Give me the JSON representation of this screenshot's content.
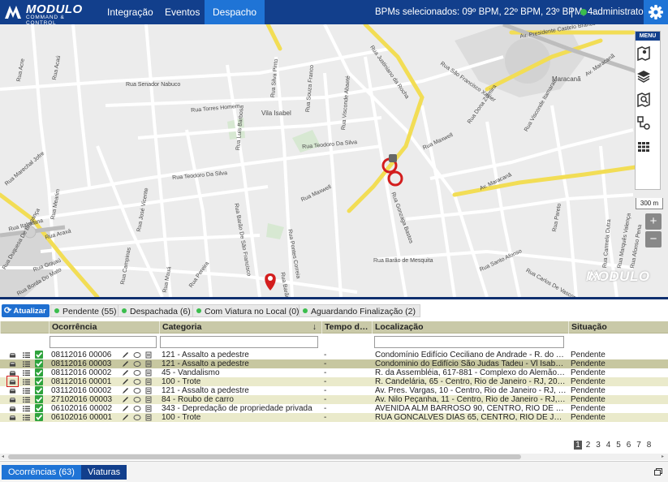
{
  "brand": {
    "name": "MODULO",
    "tagline": "COMMAND & CONTROL"
  },
  "nav": {
    "tabs": [
      {
        "label": "Integração"
      },
      {
        "label": "Eventos"
      },
      {
        "label": "Despacho",
        "active": true
      }
    ],
    "bpms": "BPMs selecionados: 09º BPM, 22º BPM, 23º BPM, 4…",
    "separator": "|",
    "user": "administrator",
    "user_status_color": "#3bbd4d"
  },
  "map": {
    "menu_label": "MENU",
    "scale": "300 m",
    "zoom_in": "+",
    "zoom_out": "−",
    "watermark": "MODULO",
    "tools": [
      "map-pin-icon",
      "layers-icon",
      "search-map-icon",
      "route-icon",
      "grid-icon"
    ],
    "streets": [
      "Rua Acre",
      "Rua Acaú",
      "Rua Senador Nabuco",
      "Rua Torres Homem",
      "Vila Isabel",
      "Rua Silva Pinto",
      "Rua Souza Franco",
      "Rua Visconde Abaeté",
      "Rua Justiniano da Rocha",
      "Rua São Francisco Xavier",
      "Av. Presidente Castelo Branco",
      "Maracanã",
      "Rua Teodoro Da Silva",
      "Rua Luis Barbosa",
      "Rua Maxwell",
      "Rua Dona Zulmira",
      "Rua Visconde Itamarati",
      "Rua Teodoro Da Silva",
      "Rua Maxwell",
      "Av. Maracanã",
      "Rua Gonzaga Bastos",
      "Rua Barão De São Francisco",
      "Rua Pontes Correia",
      "Rua Barão de Mesquita",
      "Rua Santo Afonso",
      "Rua Itabaiana",
      "Rua Araxá",
      "Rua Mearim",
      "Rua Grajaú",
      "Rua Duquesa De Bragança",
      "Rua Borda Do Mato",
      "Rua Marechal Jofre",
      "Rua José Vicente",
      "Rua Carlos De Vasconcelos",
      "Rua Pareto",
      "Rua Carmela Dutra",
      "Rua Marquês Valença",
      "Rua Afonso Pena",
      "Av. Maracanã",
      "Rua Barão De Itapu",
      "Rua Campinas",
      "Rua Mauá",
      "Rua Pereira"
    ]
  },
  "filters": {
    "refresh": "Atualizar",
    "tabs": [
      {
        "label": "Pendente (55)"
      },
      {
        "label": "Despachada (6)"
      },
      {
        "label": "Com Viatura no Local (0)"
      },
      {
        "label": "Aguardando Finalização (2)"
      }
    ],
    "status_dot_color": "#3bbd4d"
  },
  "grid": {
    "columns": [
      "Ocorrência",
      "Categoria",
      "Tempo d…",
      "Localização",
      "Situação"
    ],
    "sort_indicator": "↓",
    "rows": [
      {
        "occ": "08112016 00006",
        "cat": "121 - Assalto a pedestre",
        "time": "-",
        "loc": "Condomínio Edifício Ceciliano de Andrade - R. do …",
        "status": "Pendente"
      },
      {
        "occ": "08112016 00003",
        "cat": "121 - Assalto a pedestre",
        "time": "-",
        "loc": "Condominio do Edifício São Judas Tadeu - Vl Isabe…",
        "status": "Pendente"
      },
      {
        "occ": "08112016 00002",
        "cat": "45 - Vandalismo",
        "time": "-",
        "loc": "R. da Assembléia, 617-881 - Complexo do Alemão…",
        "status": "Pendente"
      },
      {
        "occ": "08112016 00001",
        "cat": "100 - Trote",
        "time": "-",
        "loc": "R. Candelária, 65 - Centro, Rio de Janeiro - RJ, 20…",
        "status": "Pendente"
      },
      {
        "occ": "03112016 00002",
        "cat": "121 - Assalto a pedestre",
        "time": "-",
        "loc": "Av. Pres. Vargas, 10 - Centro, Rio de Janeiro - RJ, …",
        "status": "Pendente"
      },
      {
        "occ": "27102016 00003",
        "cat": "84 - Roubo de carro",
        "time": "-",
        "loc": "Av. Nilo Peçanha, 11 - Centro, Rio de Janeiro - RJ, …",
        "status": "Pendente"
      },
      {
        "occ": "06102016 00002",
        "cat": "343 - Depredação de propriedade privada",
        "time": "-",
        "loc": "AVENIDA ALM BARROSO 90, CENTRO, RIO DE J…",
        "status": "Pendente"
      },
      {
        "occ": "06102016 00001",
        "cat": "100 - Trote",
        "time": "-",
        "loc": "RUA GONCALVES DIAS 65, CENTRO, RIO DE JA…",
        "status": "Pendente"
      }
    ],
    "pages": [
      "1",
      "2",
      "3",
      "4",
      "5",
      "6",
      "7",
      "8"
    ],
    "current_page": "1"
  },
  "bottom": {
    "tabs": [
      {
        "label": "Ocorrências (63)"
      },
      {
        "label": "Viaturas"
      }
    ]
  }
}
